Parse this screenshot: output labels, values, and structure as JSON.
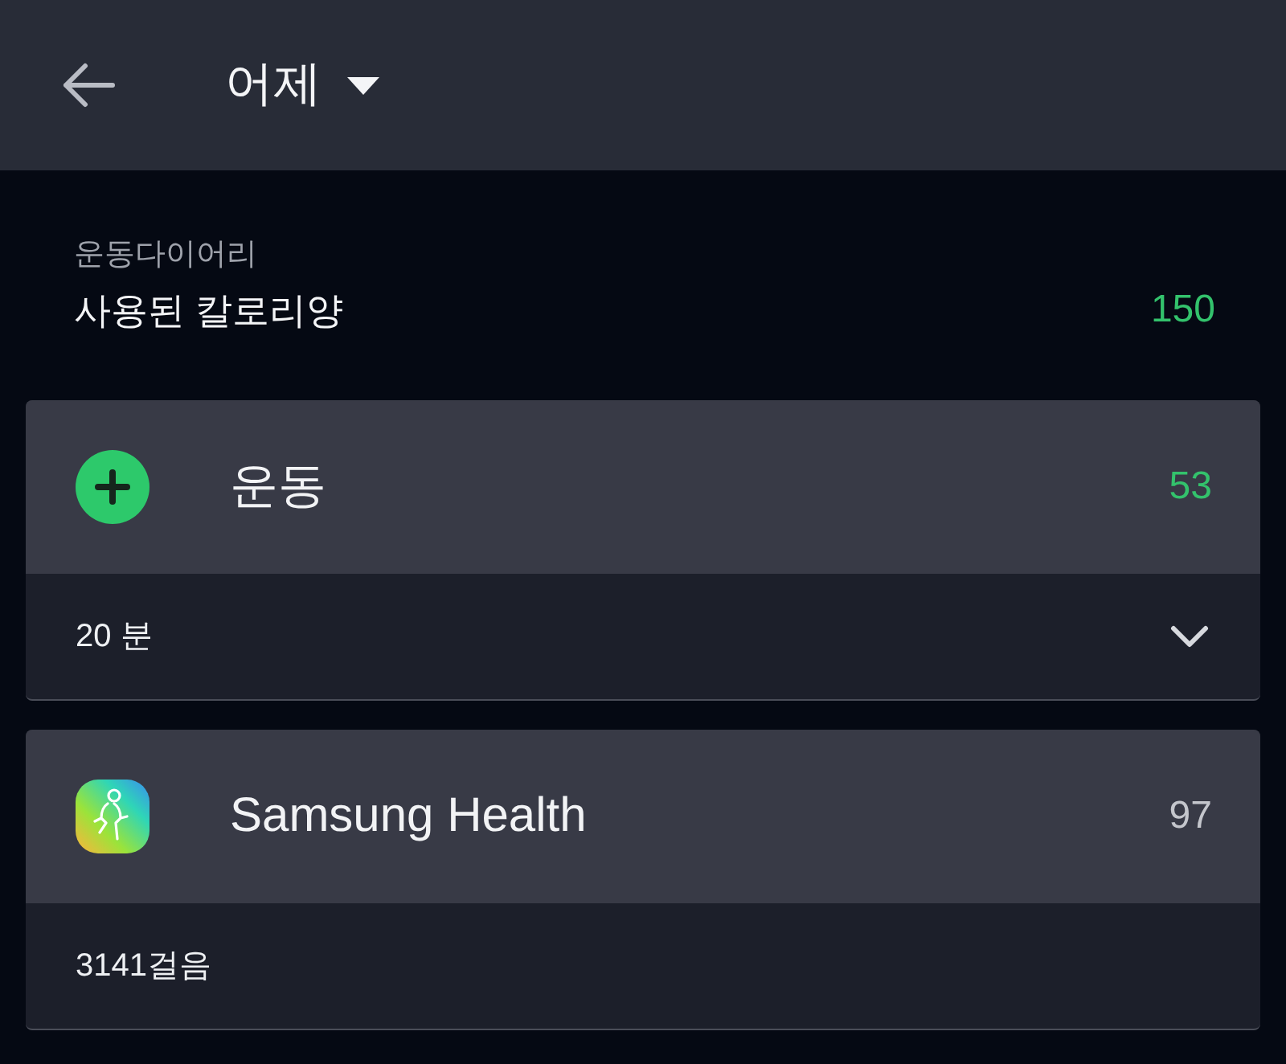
{
  "header": {
    "title": "어제"
  },
  "summary": {
    "caption": "운동다이어리",
    "label": "사용된 칼로리양",
    "value": "150"
  },
  "entries": [
    {
      "kind": "manual",
      "title": "운동",
      "value": "53",
      "detail": "20 분"
    },
    {
      "kind": "app",
      "title": "Samsung Health",
      "value": "97",
      "detail": "3141걸음"
    }
  ]
}
